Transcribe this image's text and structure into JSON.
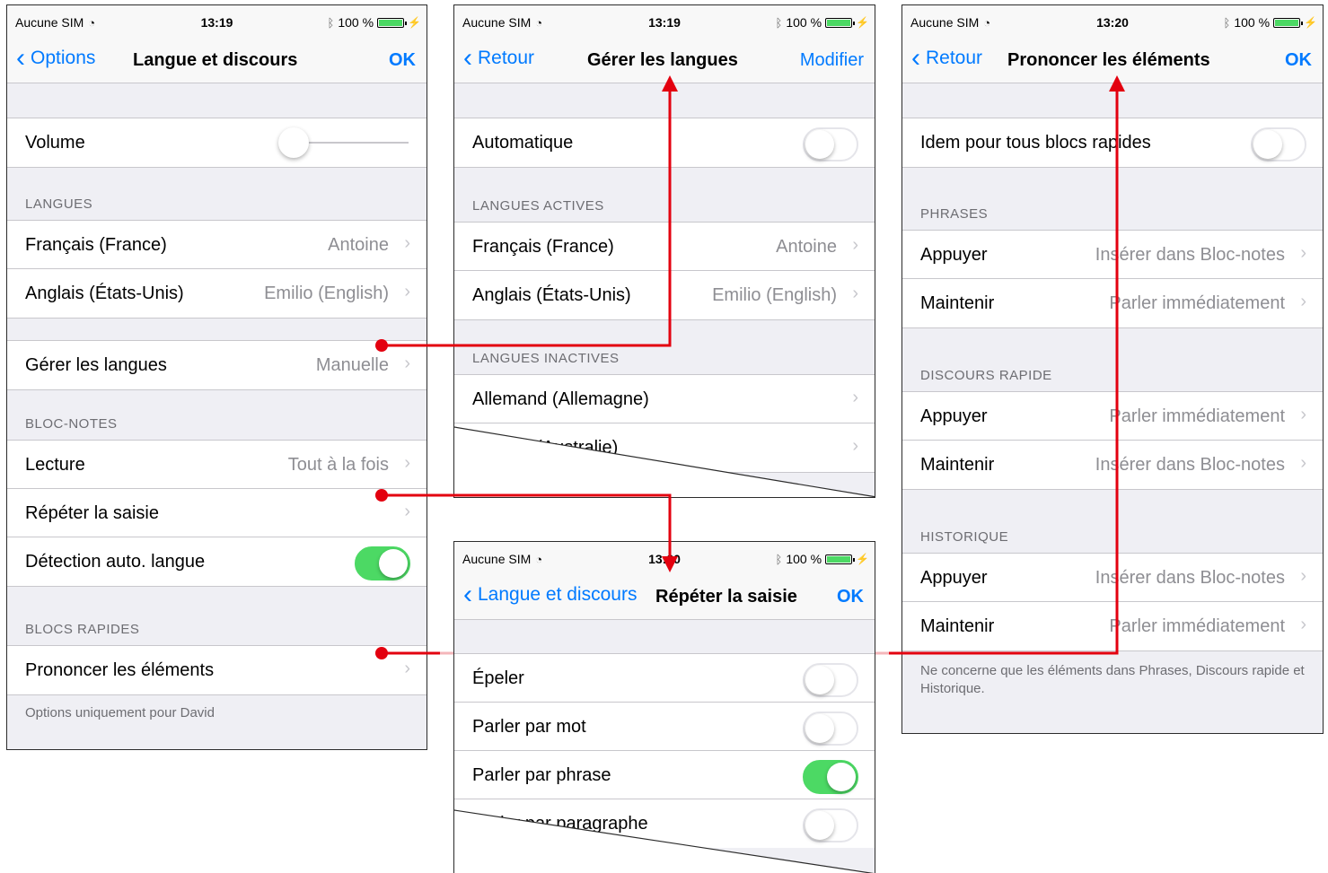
{
  "status": {
    "carrier": "Aucune SIM",
    "battery": "100 %",
    "time_s1": "13:19",
    "time_s2": "13:19",
    "time_s3": "13:20",
    "time_s4": "13:20"
  },
  "screen1": {
    "back": "Options",
    "title": "Langue et discours",
    "action": "OK",
    "volume_label": "Volume",
    "volume_level": 0.0,
    "header_langues": "LANGUES",
    "rows_langues": [
      {
        "label": "Français (France)",
        "value": "Antoine"
      },
      {
        "label": "Anglais (États-Unis)",
        "value": "Emilio (English)"
      }
    ],
    "manage_label": "Gérer les langues",
    "manage_value": "Manuelle",
    "header_bloc": "BLOC-NOTES",
    "lecture_label": "Lecture",
    "lecture_value": "Tout à la fois",
    "repeter_label": "Répéter la saisie",
    "detection_label": "Détection auto. langue",
    "detection_on": true,
    "header_blocs": "BLOCS RAPIDES",
    "prononcer_label": "Prononcer les éléments",
    "footer": "Options uniquement pour David"
  },
  "screen2": {
    "back": "Retour",
    "title": "Gérer les langues",
    "action": "Modifier",
    "auto_label": "Automatique",
    "auto_on": false,
    "header_actives": "LANGUES ACTIVES",
    "rows_actives": [
      {
        "label": "Français (France)",
        "value": "Antoine"
      },
      {
        "label": "Anglais (États-Unis)",
        "value": "Emilio (English)"
      }
    ],
    "header_inactives": "LANGUES INACTIVES",
    "rows_inactives": [
      {
        "label": "Allemand (Allemagne)"
      },
      {
        "label": "Anglais (Australie)"
      }
    ]
  },
  "screen3": {
    "back": "Retour",
    "title": "Prononcer les éléments",
    "action": "OK",
    "idem_label": "Idem pour tous blocs rapides",
    "idem_on": false,
    "header_phrases": "PHRASES",
    "rows_phrases": [
      {
        "label": "Appuyer",
        "value": "Insérer dans Bloc-notes"
      },
      {
        "label": "Maintenir",
        "value": "Parler immédiatement"
      }
    ],
    "header_discours": "DISCOURS RAPIDE",
    "rows_discours": [
      {
        "label": "Appuyer",
        "value": "Parler immédiatement"
      },
      {
        "label": "Maintenir",
        "value": "Insérer dans Bloc-notes"
      }
    ],
    "header_historique": "HISTORIQUE",
    "rows_historique": [
      {
        "label": "Appuyer",
        "value": "Insérer dans Bloc-notes"
      },
      {
        "label": "Maintenir",
        "value": "Parler immédiatement"
      }
    ],
    "footer": "Ne concerne que les éléments dans Phrases, Discours rapide et Historique."
  },
  "screen4": {
    "back": "Langue et discours",
    "title": "Répéter la saisie",
    "action": "OK",
    "rows": [
      {
        "label": "Épeler",
        "on": false
      },
      {
        "label": "Parler par mot",
        "on": false
      },
      {
        "label": "Parler par phrase",
        "on": true
      },
      {
        "label": "Parler par paragraphe",
        "on": false
      }
    ]
  },
  "colors": {
    "ios_blue": "#007aff",
    "toggle_green": "#4cd964",
    "connector_red": "#e3000f"
  }
}
